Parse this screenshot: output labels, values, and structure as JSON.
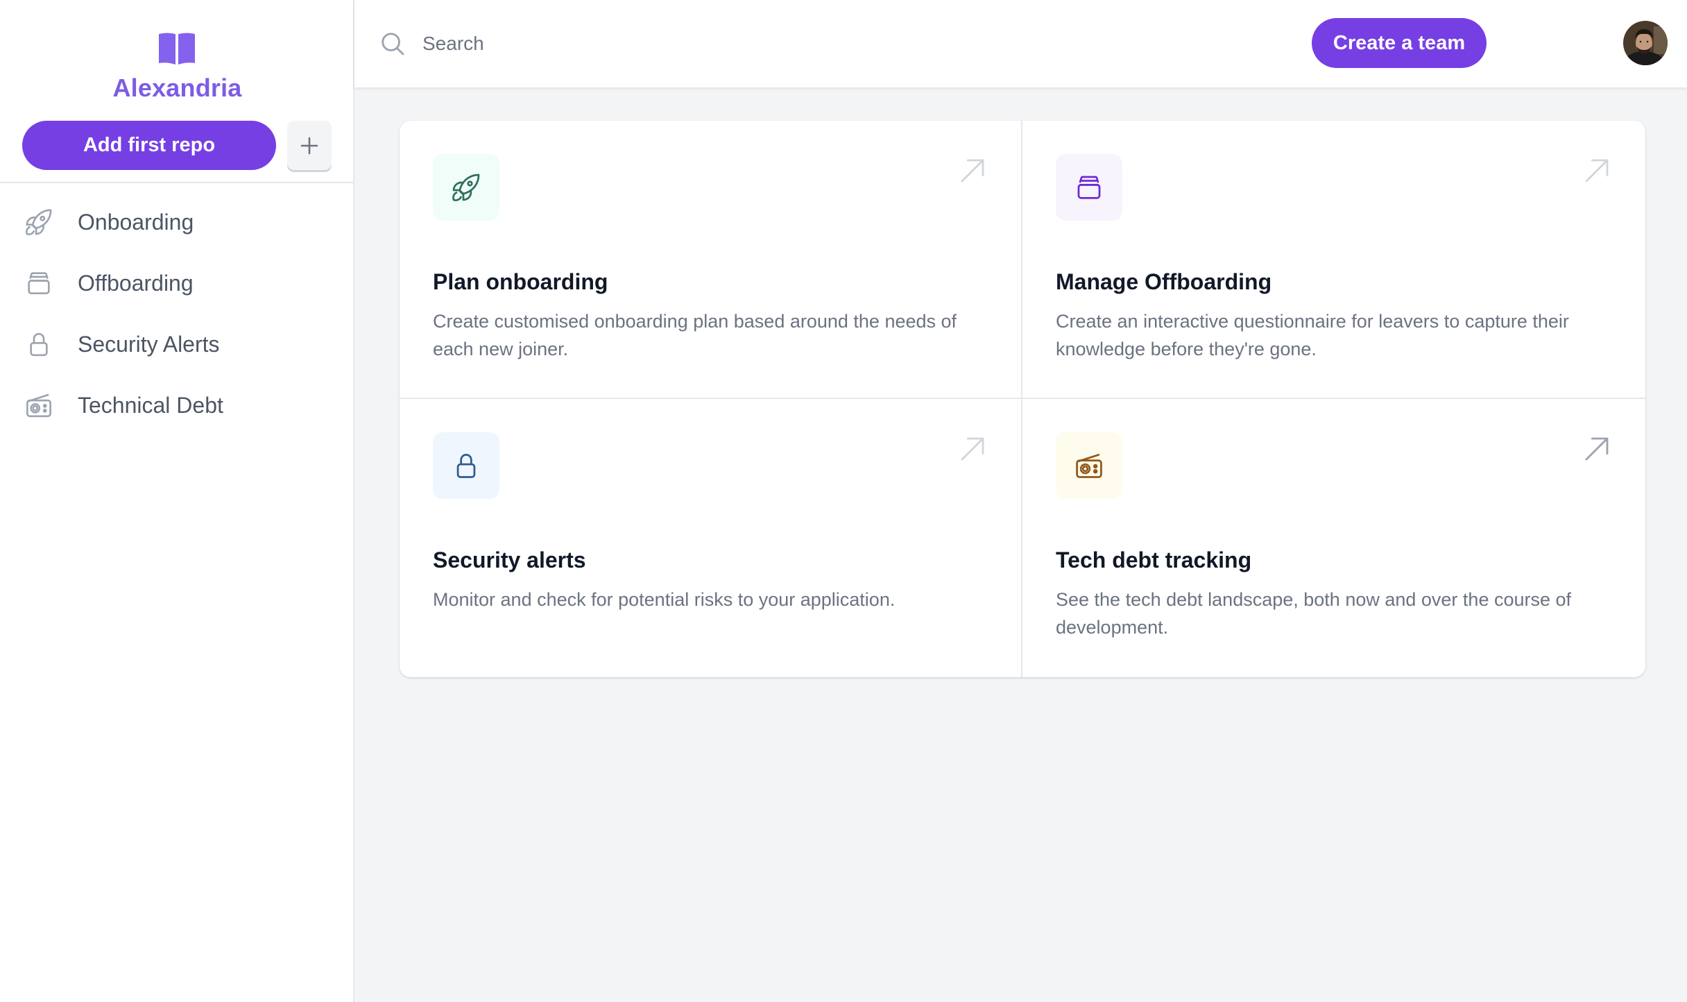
{
  "sidebar": {
    "brand": "Alexandria",
    "logo_icon": "book-open-icon",
    "add_repo_label": "Add first repo",
    "plus_icon": "plus-icon",
    "items": [
      {
        "label": "Onboarding",
        "icon": "rocket-icon"
      },
      {
        "label": "Offboarding",
        "icon": "archive-stack-icon"
      },
      {
        "label": "Security Alerts",
        "icon": "lock-icon"
      },
      {
        "label": "Technical Debt",
        "icon": "radio-icon"
      }
    ]
  },
  "header": {
    "search_placeholder": "Search",
    "search_value": "",
    "create_team_label": "Create a team",
    "avatar": "user-avatar"
  },
  "cards": [
    {
      "title": "Plan onboarding",
      "description": "Create customised onboarding plan based around the needs of each new joiner.",
      "icon": "rocket-icon",
      "icon_color": "#2F6F5E",
      "icon_bg": "#F0FDF8"
    },
    {
      "title": "Manage Offboarding",
      "description": "Create an interactive questionnaire for leavers to capture their knowledge before they're gone.",
      "icon": "archive-stack-icon",
      "icon_color": "#6D28D9",
      "icon_bg": "#F7F4FE"
    },
    {
      "title": "Security alerts",
      "description": "Monitor and check for potential risks to your application.",
      "icon": "lock-icon",
      "icon_color": "#2C5E8F",
      "icon_bg": "#EFF6FD"
    },
    {
      "title": "Tech debt tracking",
      "description": "See the tech debt landscape, both now and over the course of development.",
      "icon": "radio-icon",
      "icon_color": "#92571A",
      "icon_bg": "#FEFCEC"
    }
  ],
  "colors": {
    "accent": "#763FE3",
    "brand_text": "#7C5CE6",
    "arrow_idle": "#D1D5DB",
    "arrow_hover": "#9CA3AF"
  }
}
